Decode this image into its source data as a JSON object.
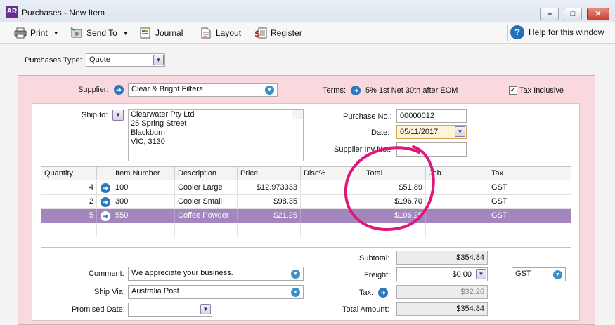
{
  "window": {
    "logo": "AR",
    "title": "Purchases - New Item"
  },
  "toolbar": {
    "print": "Print",
    "send_to": "Send To",
    "journal": "Journal",
    "layout": "Layout",
    "register": "Register",
    "help": "Help for this window"
  },
  "purchase_type": {
    "label": "Purchases Type:",
    "value": "Quote"
  },
  "supplier": {
    "label": "Supplier:",
    "value": "Clear & Bright Filters"
  },
  "terms": {
    "label": "Terms:",
    "value": "5% 1st Net 30th after EOM"
  },
  "tax_inclusive": {
    "label": "Tax Inclusive",
    "checked": true
  },
  "ship_to": {
    "label": "Ship to:",
    "lines": [
      "Clearwater Pty Ltd",
      "25 Spring Street",
      "Blackburn",
      "VIC, 3130"
    ]
  },
  "details": {
    "purchase_no_label": "Purchase No.:",
    "purchase_no": "00000012",
    "date_label": "Date:",
    "date": "05/11/2017",
    "supplier_inv_label": "Supplier Inv No.:",
    "supplier_inv": ""
  },
  "table": {
    "headers": [
      "Quantity",
      "",
      "Item Number",
      "Description",
      "Price",
      "Disc%",
      "Total",
      "Job",
      "Tax"
    ],
    "rows": [
      {
        "qty": "4",
        "item": "100",
        "desc": "Cooler Large",
        "price": "$12.973333",
        "disc": "",
        "total": "$51.89",
        "job": "",
        "tax": "GST"
      },
      {
        "qty": "2",
        "item": "300",
        "desc": "Cooler Small",
        "price": "$98.35",
        "disc": "",
        "total": "$196.70",
        "job": "",
        "tax": "GST"
      },
      {
        "qty": "5",
        "item": "550",
        "desc": "Coffee Powder",
        "price": "$21.25",
        "disc": "",
        "total": "$106.25",
        "job": "",
        "tax": "GST"
      }
    ],
    "selected_row": 2
  },
  "comment": {
    "label": "Comment:",
    "value": "We appreciate your business."
  },
  "ship_via": {
    "label": "Ship Via:",
    "value": "Australia Post"
  },
  "promised_date": {
    "label": "Promised Date:",
    "value": ""
  },
  "totals": {
    "subtotal_label": "Subtotal:",
    "subtotal": "$354.84",
    "freight_label": "Freight:",
    "freight": "$0.00",
    "freight_tax": "GST",
    "tax_label": "Tax:",
    "tax": "$32.26",
    "total_label": "Total Amount:",
    "total": "$354.84"
  },
  "annotation": {
    "color": "#e0177a",
    "target": "Total column"
  },
  "colors": {
    "panel": "#f9d9dd",
    "selected_row": "#a286bd",
    "accent_blue": "#2a78bd"
  }
}
